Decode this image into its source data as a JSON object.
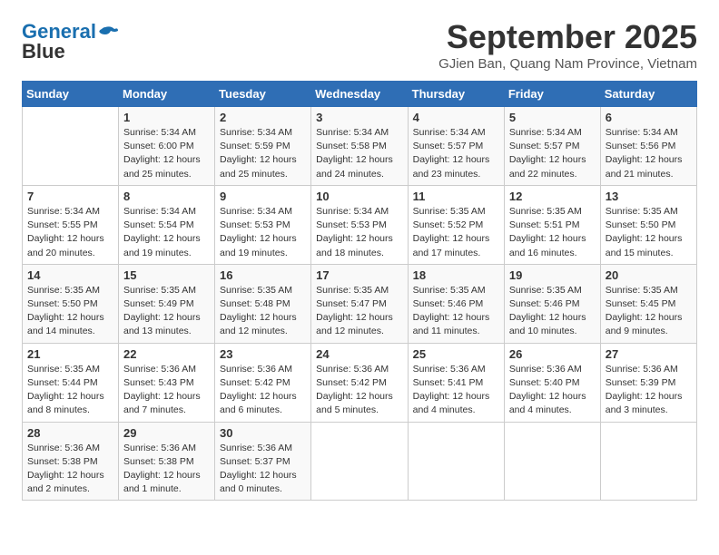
{
  "header": {
    "logo_line1": "General",
    "logo_line2": "Blue",
    "month": "September 2025",
    "location": "GJien Ban, Quang Nam Province, Vietnam"
  },
  "weekdays": [
    "Sunday",
    "Monday",
    "Tuesday",
    "Wednesday",
    "Thursday",
    "Friday",
    "Saturday"
  ],
  "weeks": [
    [
      {
        "day": "",
        "info": ""
      },
      {
        "day": "1",
        "info": "Sunrise: 5:34 AM\nSunset: 6:00 PM\nDaylight: 12 hours\nand 25 minutes."
      },
      {
        "day": "2",
        "info": "Sunrise: 5:34 AM\nSunset: 5:59 PM\nDaylight: 12 hours\nand 25 minutes."
      },
      {
        "day": "3",
        "info": "Sunrise: 5:34 AM\nSunset: 5:58 PM\nDaylight: 12 hours\nand 24 minutes."
      },
      {
        "day": "4",
        "info": "Sunrise: 5:34 AM\nSunset: 5:57 PM\nDaylight: 12 hours\nand 23 minutes."
      },
      {
        "day": "5",
        "info": "Sunrise: 5:34 AM\nSunset: 5:57 PM\nDaylight: 12 hours\nand 22 minutes."
      },
      {
        "day": "6",
        "info": "Sunrise: 5:34 AM\nSunset: 5:56 PM\nDaylight: 12 hours\nand 21 minutes."
      }
    ],
    [
      {
        "day": "7",
        "info": "Sunrise: 5:34 AM\nSunset: 5:55 PM\nDaylight: 12 hours\nand 20 minutes."
      },
      {
        "day": "8",
        "info": "Sunrise: 5:34 AM\nSunset: 5:54 PM\nDaylight: 12 hours\nand 19 minutes."
      },
      {
        "day": "9",
        "info": "Sunrise: 5:34 AM\nSunset: 5:53 PM\nDaylight: 12 hours\nand 19 minutes."
      },
      {
        "day": "10",
        "info": "Sunrise: 5:34 AM\nSunset: 5:53 PM\nDaylight: 12 hours\nand 18 minutes."
      },
      {
        "day": "11",
        "info": "Sunrise: 5:35 AM\nSunset: 5:52 PM\nDaylight: 12 hours\nand 17 minutes."
      },
      {
        "day": "12",
        "info": "Sunrise: 5:35 AM\nSunset: 5:51 PM\nDaylight: 12 hours\nand 16 minutes."
      },
      {
        "day": "13",
        "info": "Sunrise: 5:35 AM\nSunset: 5:50 PM\nDaylight: 12 hours\nand 15 minutes."
      }
    ],
    [
      {
        "day": "14",
        "info": "Sunrise: 5:35 AM\nSunset: 5:50 PM\nDaylight: 12 hours\nand 14 minutes."
      },
      {
        "day": "15",
        "info": "Sunrise: 5:35 AM\nSunset: 5:49 PM\nDaylight: 12 hours\nand 13 minutes."
      },
      {
        "day": "16",
        "info": "Sunrise: 5:35 AM\nSunset: 5:48 PM\nDaylight: 12 hours\nand 12 minutes."
      },
      {
        "day": "17",
        "info": "Sunrise: 5:35 AM\nSunset: 5:47 PM\nDaylight: 12 hours\nand 12 minutes."
      },
      {
        "day": "18",
        "info": "Sunrise: 5:35 AM\nSunset: 5:46 PM\nDaylight: 12 hours\nand 11 minutes."
      },
      {
        "day": "19",
        "info": "Sunrise: 5:35 AM\nSunset: 5:46 PM\nDaylight: 12 hours\nand 10 minutes."
      },
      {
        "day": "20",
        "info": "Sunrise: 5:35 AM\nSunset: 5:45 PM\nDaylight: 12 hours\nand 9 minutes."
      }
    ],
    [
      {
        "day": "21",
        "info": "Sunrise: 5:35 AM\nSunset: 5:44 PM\nDaylight: 12 hours\nand 8 minutes."
      },
      {
        "day": "22",
        "info": "Sunrise: 5:36 AM\nSunset: 5:43 PM\nDaylight: 12 hours\nand 7 minutes."
      },
      {
        "day": "23",
        "info": "Sunrise: 5:36 AM\nSunset: 5:42 PM\nDaylight: 12 hours\nand 6 minutes."
      },
      {
        "day": "24",
        "info": "Sunrise: 5:36 AM\nSunset: 5:42 PM\nDaylight: 12 hours\nand 5 minutes."
      },
      {
        "day": "25",
        "info": "Sunrise: 5:36 AM\nSunset: 5:41 PM\nDaylight: 12 hours\nand 4 minutes."
      },
      {
        "day": "26",
        "info": "Sunrise: 5:36 AM\nSunset: 5:40 PM\nDaylight: 12 hours\nand 4 minutes."
      },
      {
        "day": "27",
        "info": "Sunrise: 5:36 AM\nSunset: 5:39 PM\nDaylight: 12 hours\nand 3 minutes."
      }
    ],
    [
      {
        "day": "28",
        "info": "Sunrise: 5:36 AM\nSunset: 5:38 PM\nDaylight: 12 hours\nand 2 minutes."
      },
      {
        "day": "29",
        "info": "Sunrise: 5:36 AM\nSunset: 5:38 PM\nDaylight: 12 hours\nand 1 minute."
      },
      {
        "day": "30",
        "info": "Sunrise: 5:36 AM\nSunset: 5:37 PM\nDaylight: 12 hours\nand 0 minutes."
      },
      {
        "day": "",
        "info": ""
      },
      {
        "day": "",
        "info": ""
      },
      {
        "day": "",
        "info": ""
      },
      {
        "day": "",
        "info": ""
      }
    ]
  ]
}
